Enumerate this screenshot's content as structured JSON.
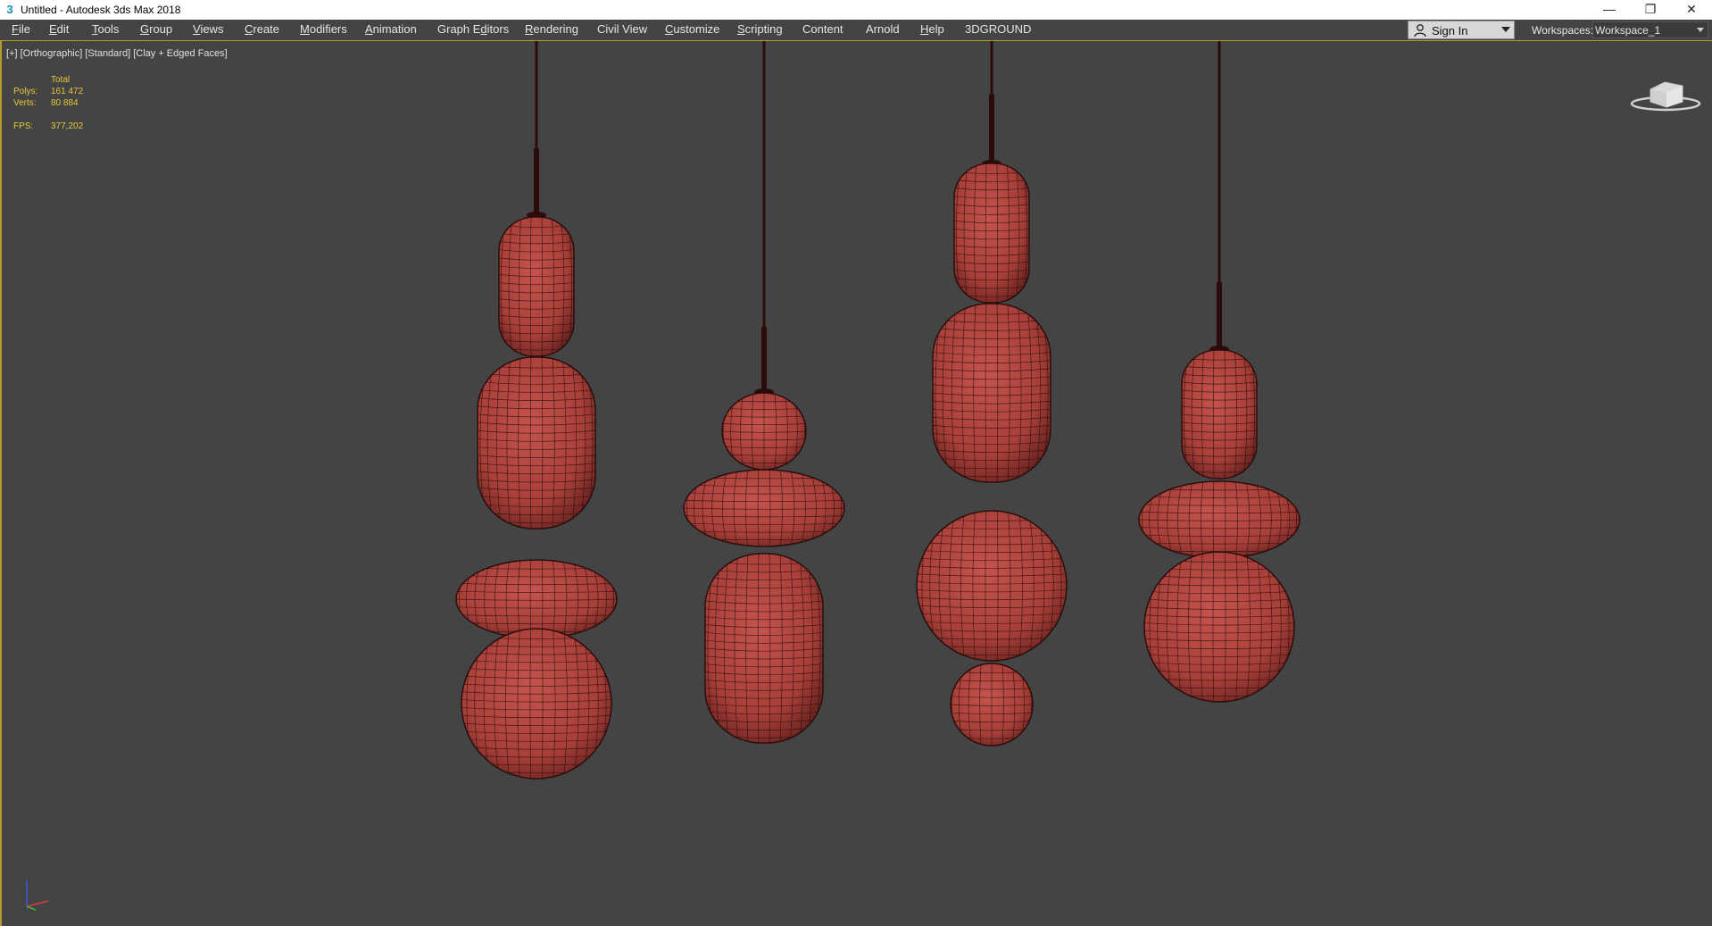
{
  "window": {
    "title": "Untitled - Autodesk 3ds Max 2018",
    "app_icon": "3",
    "controls": {
      "minimize": "—",
      "restore": "❐",
      "close": "✕"
    }
  },
  "menubar": {
    "items": [
      {
        "pre": "",
        "u": "F",
        "post": "ile"
      },
      {
        "pre": "",
        "u": "E",
        "post": "dit"
      },
      {
        "pre": "",
        "u": "T",
        "post": "ools"
      },
      {
        "pre": "",
        "u": "G",
        "post": "roup"
      },
      {
        "pre": "",
        "u": "V",
        "post": "iews"
      },
      {
        "pre": "",
        "u": "C",
        "post": "reate"
      },
      {
        "pre": "",
        "u": "M",
        "post": "odifiers"
      },
      {
        "pre": "",
        "u": "A",
        "post": "nimation"
      },
      {
        "pre": "Graph E",
        "u": "d",
        "post": "itors"
      },
      {
        "pre": "",
        "u": "R",
        "post": "endering"
      },
      {
        "pre": "Civil View",
        "u": "",
        "post": ""
      },
      {
        "pre": "",
        "u": "C",
        "post": "ustomize"
      },
      {
        "pre": "",
        "u": "S",
        "post": "cripting"
      },
      {
        "pre": "Content",
        "u": "",
        "post": ""
      },
      {
        "pre": "Arnold",
        "u": "",
        "post": ""
      },
      {
        "pre": "",
        "u": "H",
        "post": "elp"
      },
      {
        "pre": "3DGROUND",
        "u": "",
        "post": ""
      }
    ],
    "signin_label": "Sign In",
    "workspaces_label": "Workspaces:",
    "workspace_value": "Workspace_1"
  },
  "viewport": {
    "label": {
      "plus": "[+]",
      "view": "[Orthographic]",
      "shading": "[Standard]",
      "style": "[Clay + Edged Faces]"
    },
    "stats": {
      "header": "Total",
      "polys_label": "Polys:",
      "polys_value": "161 472",
      "verts_label": "Verts:",
      "verts_value": "80 884",
      "fps_label": "FPS:",
      "fps_value": "377,202"
    }
  },
  "colors": {
    "background": "#444444",
    "accent": "#b69a2a",
    "stats_text": "#e6c93a",
    "mesh_fill": "#b0453f",
    "mesh_wire": "#2a0e0c",
    "cord": "#2b0b0b"
  }
}
